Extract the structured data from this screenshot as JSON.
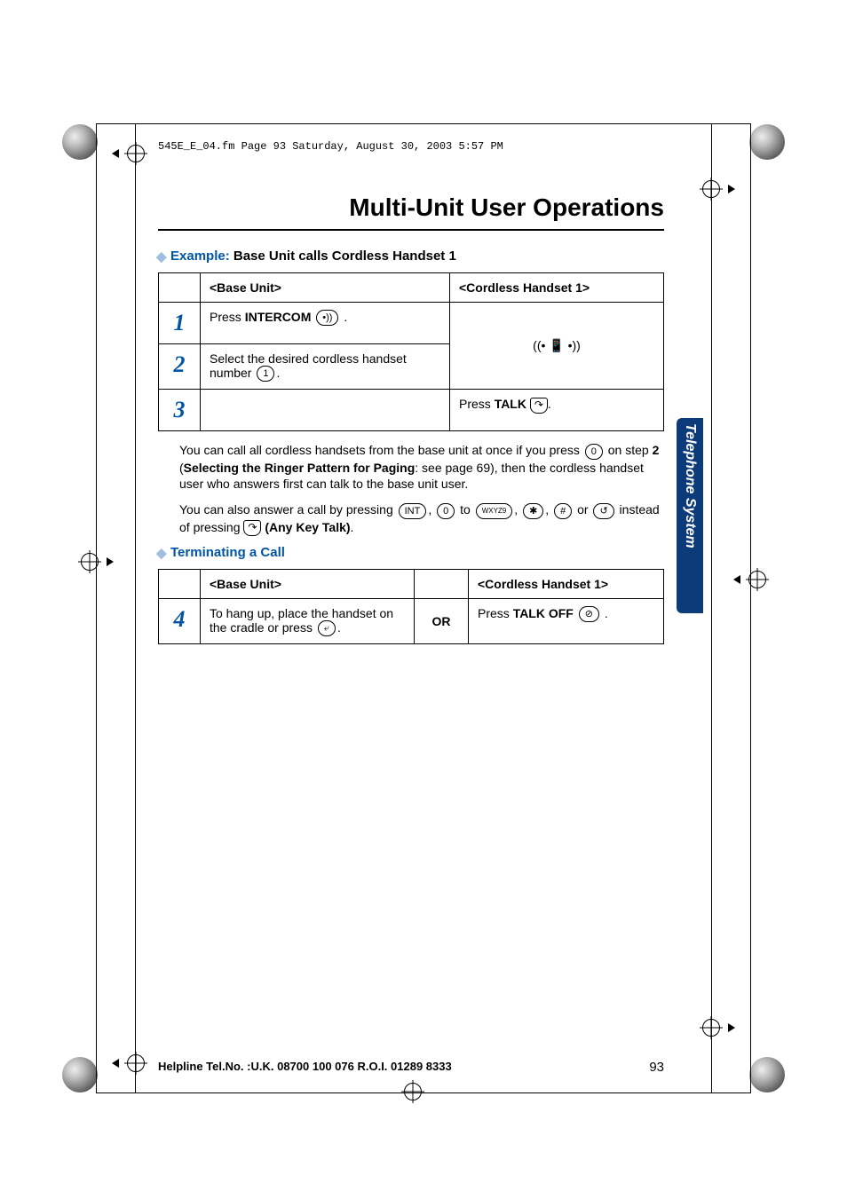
{
  "header_line": "545E_E_04.fm  Page 93  Saturday, August 30, 2003  5:57 PM",
  "title": "Multi-Unit User Operations",
  "side_tab": "Telephone System",
  "section1": {
    "label": "Example:",
    "sub": "Base Unit calls Cordless Handset 1",
    "col_a": "<Base Unit>",
    "col_b": "<Cordless Handset 1>",
    "row1_a_pre": "Press ",
    "row1_a_bold": "INTERCOM",
    "row1_a_post": " .",
    "row2_a": "Select the desired cordless handset number ",
    "row2_a_post": ".",
    "row3_b_pre": "Press ",
    "row3_b_bold": "TALK",
    "row3_b_post": "."
  },
  "para1_a": "You can call all cordless handsets from the base unit at once if you press ",
  "para1_b": " on step ",
  "para1_c": "2",
  "para1_d": " (",
  "para1_e": "Selecting the Ringer Pattern for Paging",
  "para1_f": ": see page 69), then the cordless handset user who answers first can talk to the base unit user.",
  "para2_a": "You can also answer a call by pressing ",
  "para2_b": ", ",
  "para2_c": " to ",
  "para2_d": ", ",
  "para2_e": ", ",
  "para2_f": " or ",
  "para2_g": " instead of pressing ",
  "para2_h": " (Any Key Talk)",
  "para2_i": ".",
  "section2": {
    "label": "Terminating a Call",
    "col_a": "<Base Unit>",
    "col_b": "<Cordless Handset 1>",
    "or": "OR",
    "row4_a": "To hang up, place the handset on the cradle or press ",
    "row4_a_post": ".",
    "row4_b_pre": "Press ",
    "row4_b_bold": "TALK OFF",
    "row4_b_post": " ."
  },
  "icons": {
    "intercom": "•))",
    "one": "1",
    "zero": "0",
    "int": "INT",
    "nine": "WXYZ9",
    "star": "✱",
    "hash": "#",
    "redial": "↺",
    "talk": "↷",
    "speaker": "⤶",
    "talkoff": "⊘"
  },
  "footer": {
    "help": "Helpline Tel.No. :U.K. 08700 100 076  R.O.I. 01289 8333",
    "page": "93"
  }
}
